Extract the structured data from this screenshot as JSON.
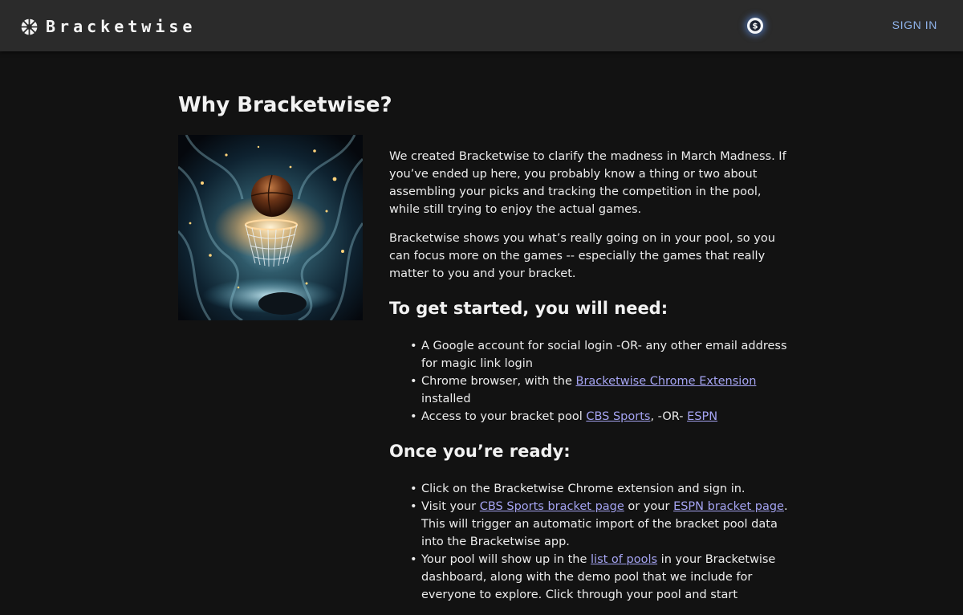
{
  "header": {
    "logo_text": "Bracketwise",
    "logo_icon": "snowflake-icon",
    "coin_icon": "dollar-coin-icon",
    "signin_label": "SIGN IN"
  },
  "main": {
    "title": "Why Bracketwise?",
    "hero_image": "basketball-hoop-illustration",
    "intro_p1": "We created Bracketwise to clarify the madness in March Madness. If you’ve ended up here, you probably know a thing or two about assembling your picks and tracking the competition in the pool, while still trying to enjoy the actual games.",
    "intro_p2": "Bracketwise shows you what’s really going on in your pool, so you can focus more on the games -- especially the games that really matter to you and your bracket.",
    "need_heading": "To get started, you will need:",
    "need_items": {
      "item1": "A Google account for social login -OR- any other email address for magic link login",
      "item2_pre": "Chrome browser, with the ",
      "item2_link": "Bracketwise Chrome Extension",
      "item2_post": " installed",
      "item3_pre": "Access to your bracket pool ",
      "item3_link1": "CBS Sports",
      "item3_mid": ", -OR- ",
      "item3_link2": "ESPN"
    },
    "ready_heading": "Once you’re ready:",
    "ready_items": {
      "item1": "Click on the Bracketwise Chrome extension and sign in.",
      "item2_pre": "Visit your ",
      "item2_link1": "CBS Sports bracket page",
      "item2_mid": " or your ",
      "item2_link2": "ESPN bracket page",
      "item2_post": ".  This will trigger an automatic import of the bracket pool data into the Bracketwise app.",
      "item3_pre": "Your pool will show up in the ",
      "item3_link": "list of pools",
      "item3_post": " in your Bracketwise dashboard, along with the demo pool that we include for everyone to explore.  Click through your pool and start"
    }
  },
  "colors": {
    "background": "#121212",
    "topbar": "#2b2b2b",
    "link": "#a5a4f2",
    "signin": "#90b4ec"
  }
}
